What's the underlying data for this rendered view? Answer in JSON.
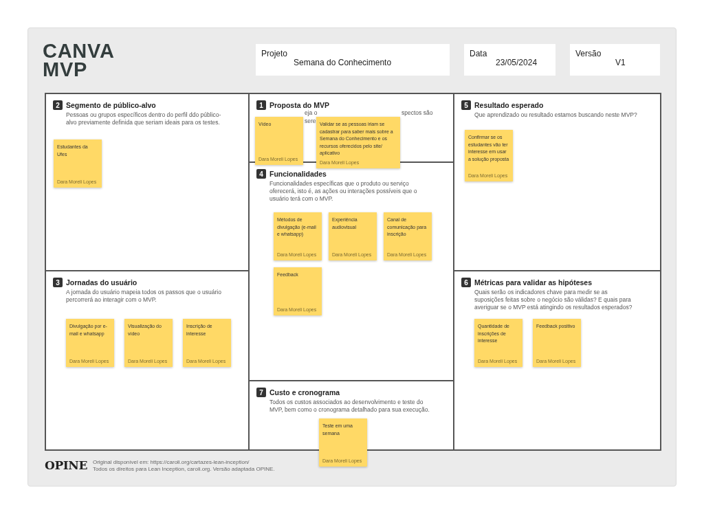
{
  "logo": [
    "CANVA",
    "MVP"
  ],
  "fields": [
    {
      "label": "Projeto",
      "value": "Semana do Conhecimento"
    },
    {
      "label": "Data",
      "value": "23/05/2024"
    },
    {
      "label": "Versão",
      "value": "V1"
    }
  ],
  "sections": [
    {
      "number": "2",
      "title": "Segmento de público-alvo",
      "description": "Pessoas ou grupos específicos dentro do perfil ddo público-alvo previamente definida que seriam ideais para os testes.",
      "notes": [
        {
          "text": "Estudantes da Ufes",
          "author": "Dara Moreli Lopes"
        }
      ]
    },
    {
      "number": "3",
      "title": "Jornadas do usuário",
      "description": "A jornada do usuário mapeia todos os passos que o usuário percorrerá ao interagir com o MVP.",
      "notes": [
        {
          "text": "Divulgação por e-mail e whatsapp",
          "author": "Dara Moreli Lopes"
        },
        {
          "text": "Visualização do vídeo",
          "author": "Dara Moreli Lopes"
        },
        {
          "text": "Inscrição de interesse",
          "author": "Dara Moreli Lopes"
        }
      ]
    },
    {
      "number": "1",
      "title": "Proposta do MVP",
      "description_fragments": [
        "eja o",
        "spectos são",
        "sere"
      ],
      "notes": [
        {
          "text": "Vídeo",
          "author": "Dara Moreli Lopes"
        },
        {
          "text": "Validar se as pessoas iriam se cadastrar para saber mais sobre a Semana do Conhecimento e os recursos oferecidos pelo site/ aplicativo",
          "author": "Dara Moreli Lopes"
        }
      ]
    },
    {
      "number": "4",
      "title": "Funcionalidades",
      "description": "Funcionalidades específicas que o produto ou serviço oferecerá, isto é, as ações ou interações possíveis que o usuário terá com o MVP.",
      "notes": [
        {
          "text": "Métodos de divulgação (e-mail e whatsapp)",
          "author": "Dara Moreli Lopes"
        },
        {
          "text": "Experiência audiovisual",
          "author": "Dara Moreli Lopes"
        },
        {
          "text": "Canal de comunicação para inscrição",
          "author": "Dara Moreli Lopes"
        },
        {
          "text": "Feedback",
          "author": "Dara Moreli Lopes"
        }
      ]
    },
    {
      "number": "7",
      "title": "Custo e cronograma",
      "description": "Todos os custos associados ao desenvolvimento e teste do MVP, bem como o cronograma detalhado para sua execução.",
      "notes": [
        {
          "text": "Teste em uma semana",
          "author": "Dara Moreli Lopes"
        }
      ]
    },
    {
      "number": "5",
      "title": "Resultado esperado",
      "description": "Que aprendizado ou resultado estamos buscando neste MVP?",
      "notes": [
        {
          "text": "Confirmar se os estudantes vão ter interesse em usar a solução proposta",
          "author": "Dara Moreli Lopes"
        }
      ]
    },
    {
      "number": "6",
      "title": "Métricas para validar as hipóteses",
      "description": "Quais serão os indicadores chave para medir se as suposições feitas sobre o negócio são válidas? E quais para averiguar se o MVP está atingindo os resultados esperados?",
      "notes": [
        {
          "text": "Quantidade de inscrições de interesse",
          "author": "Dara Moreli Lopes"
        },
        {
          "text": "Feedback positivo",
          "author": "Dara Moreli Lopes"
        }
      ]
    }
  ],
  "footer": {
    "brand": "OPINE",
    "lines": [
      "Original disponível em: https://caroli.org/cartazes-lean-inception/",
      "Todos os direitos para Lean Inception, caroli.org. Versão adaptada OPINE."
    ]
  }
}
